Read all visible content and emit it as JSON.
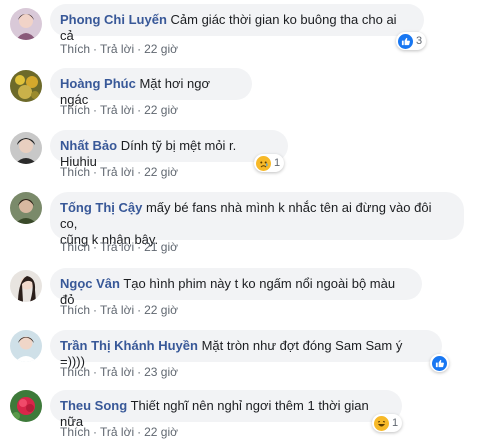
{
  "comments": [
    {
      "author": "Phong Chi Luyến",
      "text": "Cảm giác thời gian ko buông tha cho ai cả",
      "like": "Thích",
      "reply": "Trả lời",
      "time": "22 giờ",
      "reaction": {
        "type": "like",
        "count": "3"
      }
    },
    {
      "author": "Hoàng Phúc",
      "text": "Mặt hơi ngơ ngác",
      "like": "Thích",
      "reply": "Trả lời",
      "time": "22 giờ"
    },
    {
      "author": "Nhất Bảo",
      "text": "Dính tỹ bị mệt mỏi r. Hiuhiu",
      "like": "Thích",
      "reply": "Trả lời",
      "time": "22 giờ",
      "reaction": {
        "type": "sad",
        "count": "1"
      }
    },
    {
      "author": "Tống Thị Cậy",
      "text": "mấy bé fans nhà mình k nhắc tên ai đừng vào đôi co,",
      "text2": "cũng k nhận bây.",
      "like": "Thích",
      "reply": "Trả lời",
      "time": "21 giờ"
    },
    {
      "author": "Ngọc Vân",
      "text": "Tạo hình phim này t ko ngấm nổi ngoài bộ màu đỏ",
      "like": "Thích",
      "reply": "Trả lời",
      "time": "22 giờ"
    },
    {
      "author": "Trần Thị Khánh Huyền",
      "text": "Mặt tròn như đợt đóng Sam Sam ý =))))",
      "like": "Thích",
      "reply": "Trả lời",
      "time": "23 giờ",
      "reaction": {
        "type": "like",
        "count": ""
      }
    },
    {
      "author": "Theu Song",
      "text": "Thiết nghĩ nên nghỉ ngơi thêm 1 thời gian nữa",
      "like": "Thích",
      "reply": "Trả lời",
      "time": "22 giờ",
      "reaction": {
        "type": "haha",
        "count": "1"
      }
    }
  ],
  "colors": {
    "author": "#385898",
    "bubble": "#f2f3f5",
    "meta": "#606770",
    "like_blue": "#1877f2",
    "emoji_yellow": "#f7b928"
  }
}
